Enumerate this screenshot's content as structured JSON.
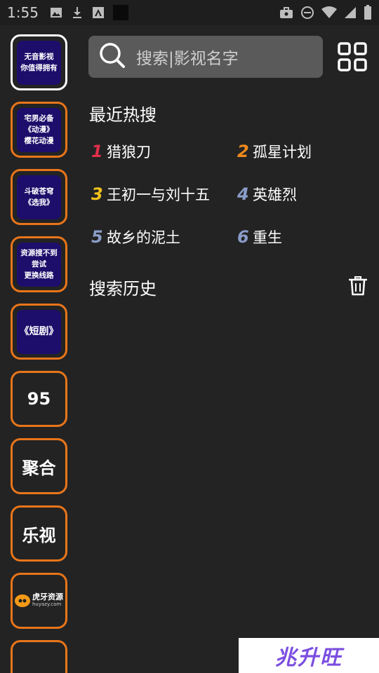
{
  "status_bar": {
    "time": "1:55",
    "left_icons": [
      "image-icon",
      "download-icon",
      "text-a-icon",
      "square-icon"
    ],
    "right_icons": [
      "briefcase-icon",
      "minus-circle-icon",
      "wifi-icon",
      "signal-icon",
      "battery-icon"
    ]
  },
  "sidebar": {
    "items": [
      {
        "label": "无音影视\n你值得拥有",
        "style": "card",
        "active": true
      },
      {
        "label": "宅男必备\n《动漫》\n樱花动漫",
        "style": "card",
        "active": false
      },
      {
        "label": "斗破苍穹\n《选我》",
        "style": "card",
        "active": false
      },
      {
        "label": "资源搜不到\n尝试\n更换线路",
        "style": "card",
        "active": false
      },
      {
        "label": "《短剧》",
        "style": "card",
        "active": false
      },
      {
        "label": "95",
        "style": "text",
        "active": false
      },
      {
        "label": "聚合",
        "style": "text",
        "active": false
      },
      {
        "label": "乐视",
        "style": "text",
        "active": false
      },
      {
        "label": "虎牙资源",
        "sublabel": "huyazy.com",
        "style": "logo",
        "active": false
      },
      {
        "label": "",
        "style": "partial",
        "active": false
      }
    ]
  },
  "search": {
    "placeholder": "搜索|影视名字"
  },
  "hot_search": {
    "title": "最近热搜",
    "items": [
      {
        "rank": "1",
        "name": "猎狼刀",
        "color": "#e0304a"
      },
      {
        "rank": "2",
        "name": "孤星计划",
        "color": "#f08a1c"
      },
      {
        "rank": "3",
        "name": "王初一与刘十五",
        "color": "#f2c21b"
      },
      {
        "rank": "4",
        "name": "英雄烈",
        "color": "#8a9cc8"
      },
      {
        "rank": "5",
        "name": "故乡的泥土",
        "color": "#8a9cc8"
      },
      {
        "rank": "6",
        "name": "重生",
        "color": "#8a9cc8"
      }
    ]
  },
  "history": {
    "title": "搜索历史"
  },
  "watermark": {
    "text": "兆升旺"
  },
  "colors": {
    "background": "#232323",
    "accent_border": "#e8751a",
    "card_fill": "#1d0e6b",
    "search_fill": "#5a5a5a"
  }
}
